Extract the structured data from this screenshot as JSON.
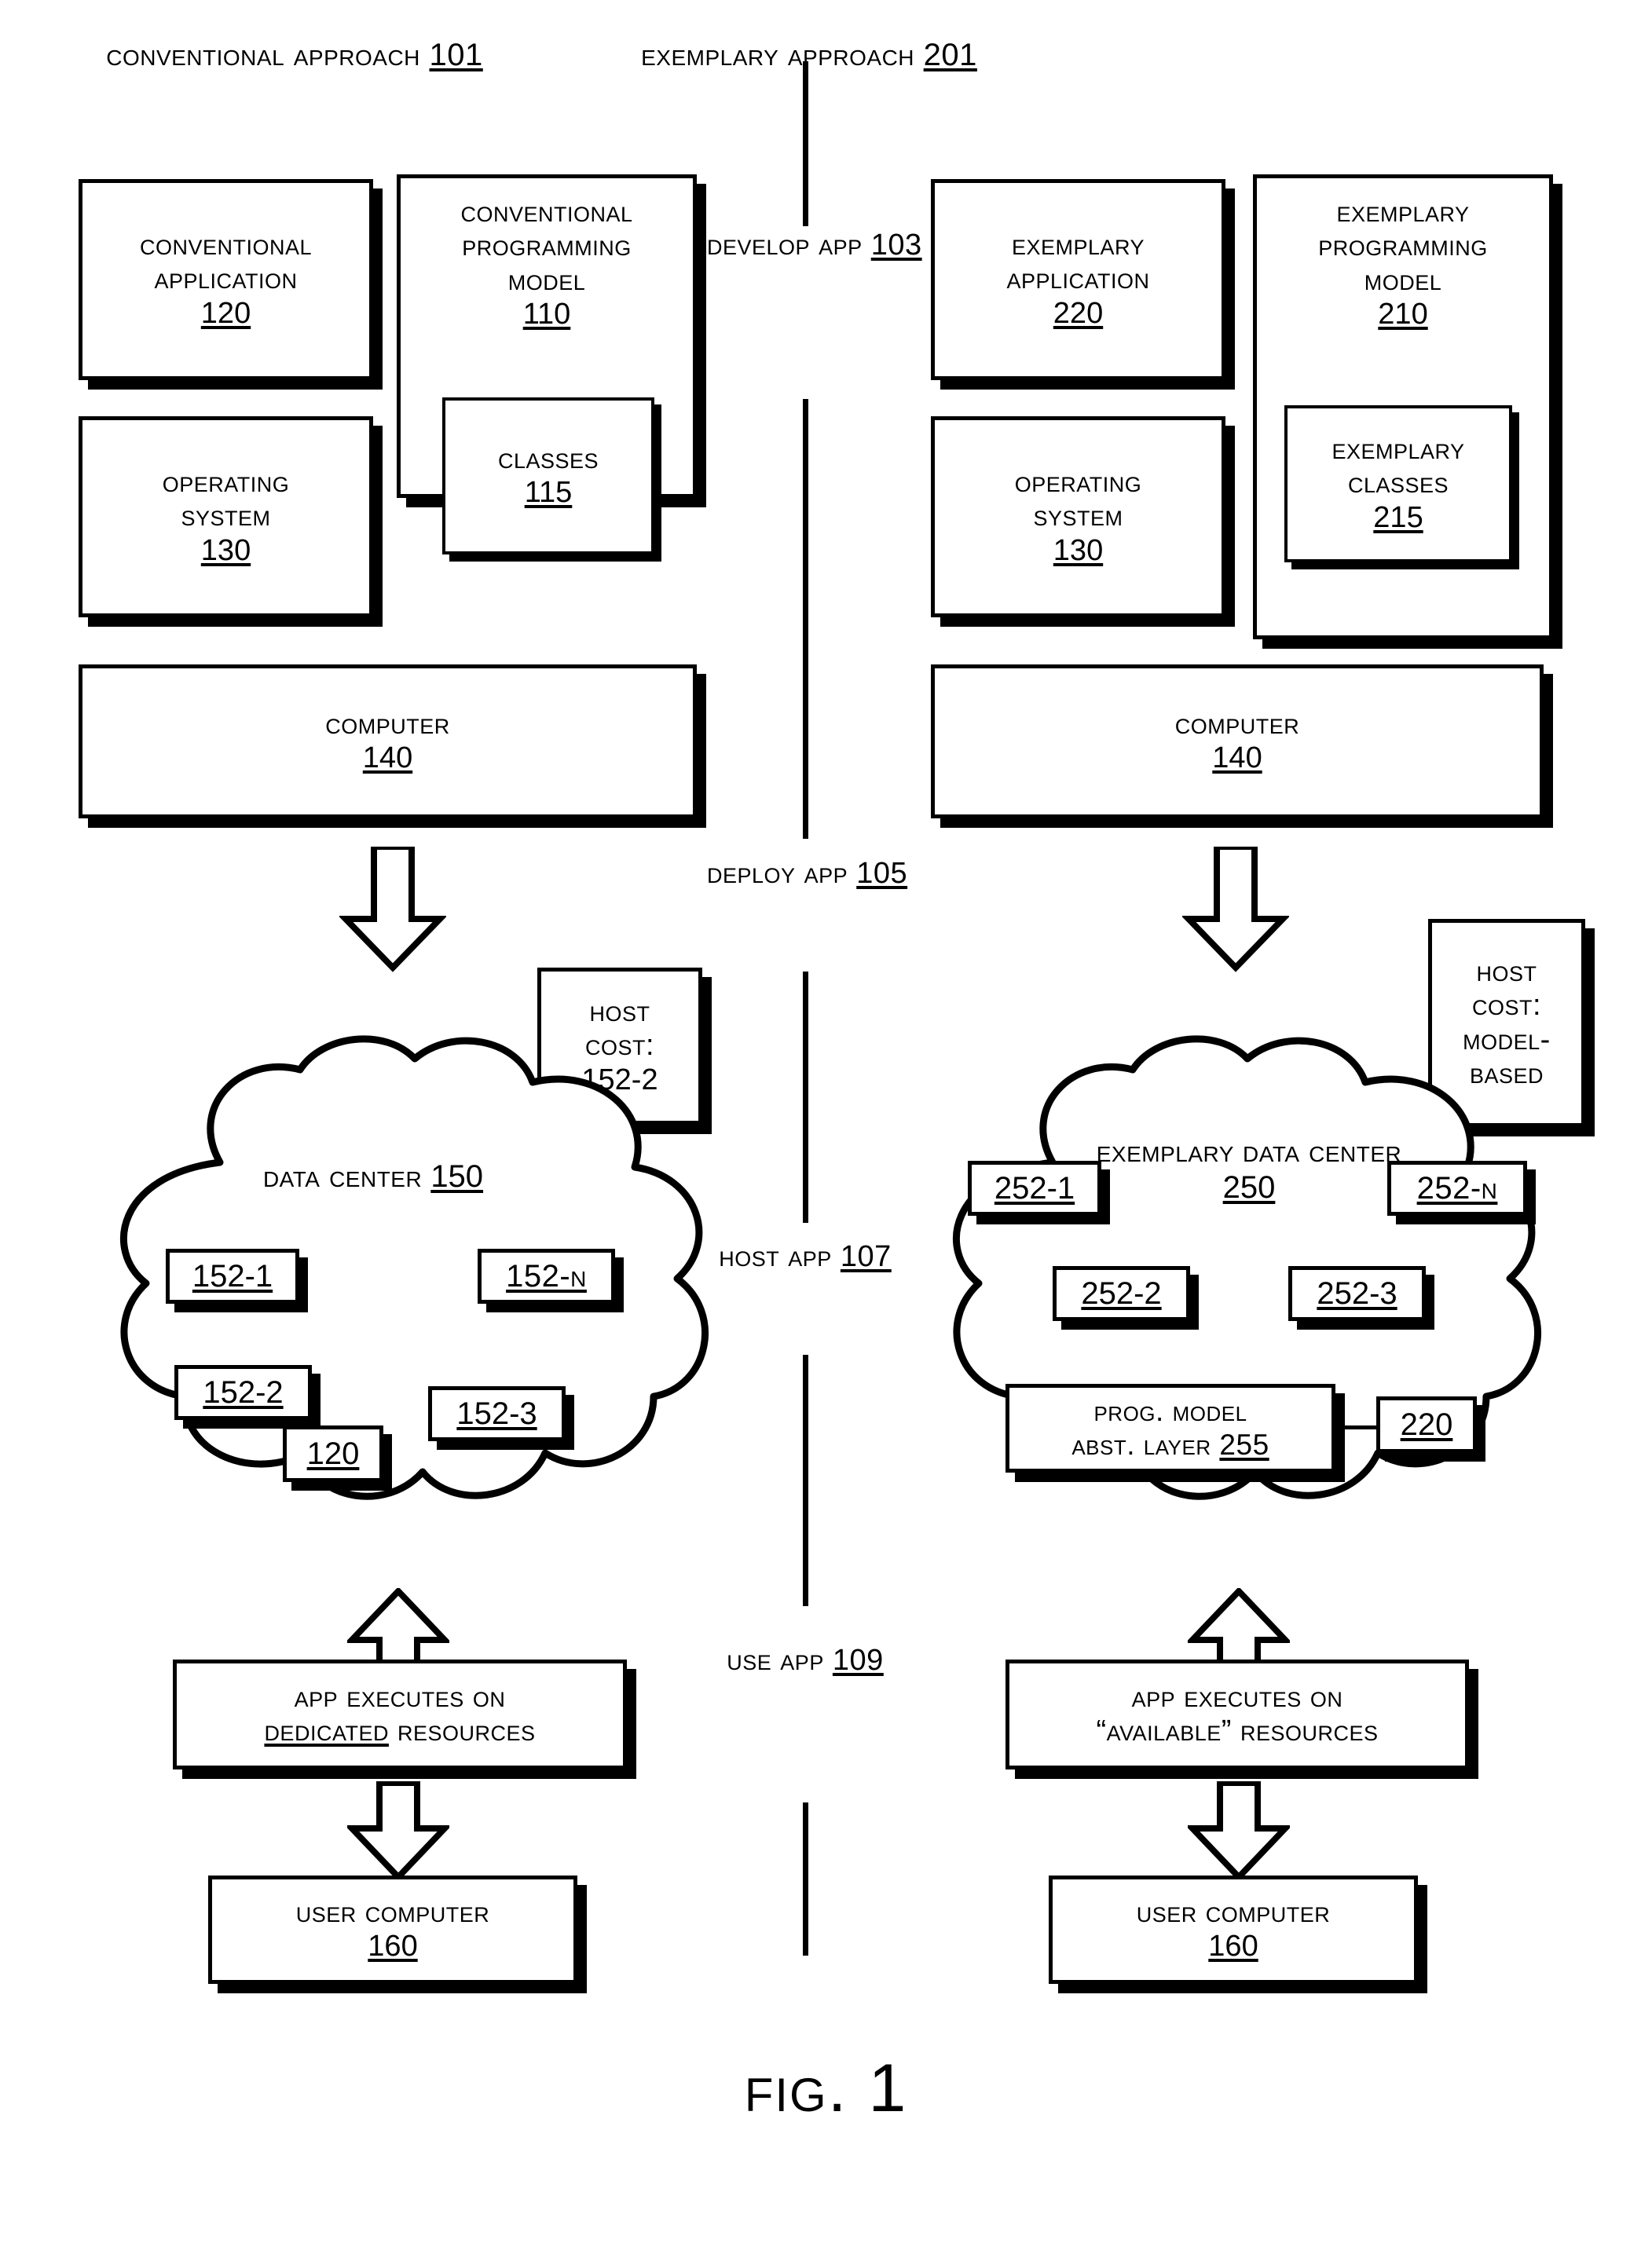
{
  "figure": {
    "caption": "FIG. 1"
  },
  "columns": {
    "left": {
      "heading_text": "Conventional Approach",
      "heading_ref": "101"
    },
    "right": {
      "heading_text": "Exemplary Approach",
      "heading_ref": "201"
    }
  },
  "stages": [
    {
      "line1": "Develop",
      "line2": "App",
      "ref": "103"
    },
    {
      "line1": "Deploy",
      "line2": "App",
      "ref": "105"
    },
    {
      "line1": "Host",
      "line2": "App",
      "ref": "107"
    },
    {
      "line1": "Use",
      "line2": "App",
      "ref": "109"
    }
  ],
  "left_column": {
    "application": {
      "line1": "Conventional",
      "line2": "Application",
      "ref": "120"
    },
    "operating_system": {
      "line1": "Operating",
      "line2": "System",
      "ref": "130"
    },
    "programming_model": {
      "line1": "Conventional",
      "line2": "Programming",
      "line3": "Model",
      "ref": "110"
    },
    "classes": {
      "line1": "Classes",
      "ref": "115"
    },
    "computer": {
      "line1": "Computer",
      "ref": "140"
    },
    "host_cost": {
      "line1": "Host",
      "line2": "Cost:",
      "line3": "152-2"
    },
    "data_center": {
      "line1": "Data Center",
      "ref": "150"
    },
    "resources": [
      {
        "label": "152-1"
      },
      {
        "label": "152-N"
      },
      {
        "label": "152-2"
      },
      {
        "label": "152-3"
      },
      {
        "label": "120"
      }
    ],
    "execution": {
      "line1": "App Executes on",
      "line2_prefix": "",
      "line2_emph": "Dedicated",
      "line2_suffix": " Resources"
    },
    "user_computer": {
      "line1": "User Computer",
      "ref": "160"
    }
  },
  "right_column": {
    "application": {
      "line1": "Exemplary",
      "line2": "Application",
      "ref": "220"
    },
    "operating_system": {
      "line1": "Operating",
      "line2": "System",
      "ref": "130"
    },
    "programming_model": {
      "line1": "Exemplary",
      "line2": "Programming",
      "line3": "Model",
      "ref": "210"
    },
    "classes": {
      "line1": "Exemplary",
      "line2": "Classes",
      "ref": "215"
    },
    "computer": {
      "line1": "Computer",
      "ref": "140"
    },
    "host_cost": {
      "line1": "Host",
      "line2": "Cost:",
      "line3": "Model-",
      "line4": "Based"
    },
    "data_center": {
      "line1": "Exemplary",
      "line2": "Data Center",
      "ref": "250"
    },
    "resources": [
      {
        "label": "252-1"
      },
      {
        "label": "252-N"
      },
      {
        "label": "252-2"
      },
      {
        "label": "252-3"
      },
      {
        "label": "220"
      }
    ],
    "abstraction_layer": {
      "line1": "Prog. Model",
      "line2": "Abst. Layer",
      "ref": "255"
    },
    "execution": {
      "line1": "App Executes on",
      "line2": "“Available” Resources"
    },
    "user_computer": {
      "line1": "User Computer",
      "ref": "160"
    }
  },
  "colors": {
    "ink": "#000000",
    "paper": "#ffffff"
  }
}
